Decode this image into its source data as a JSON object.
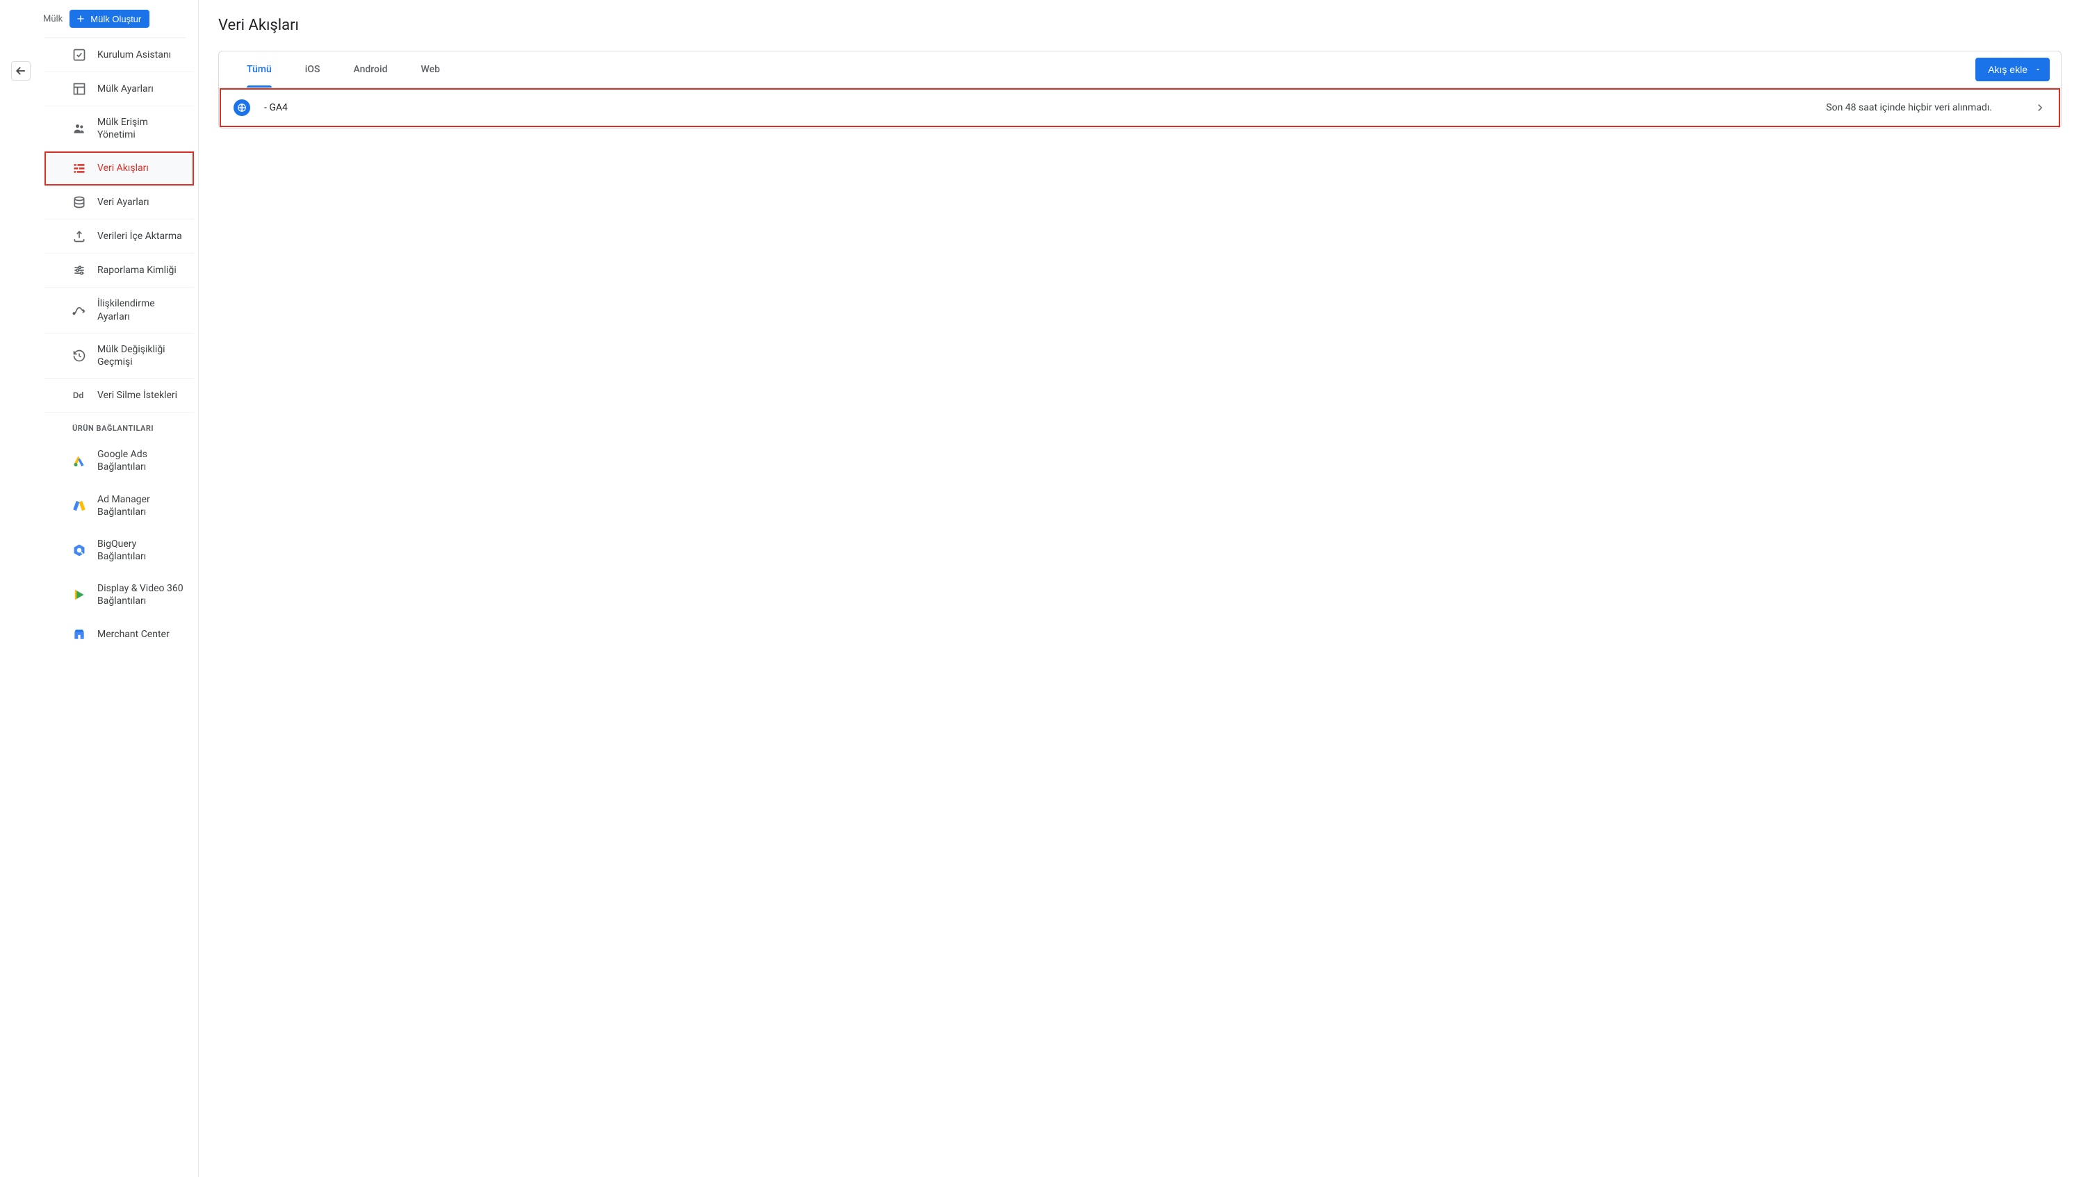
{
  "sidebar": {
    "property_label": "Mülk",
    "create_button": "Mülk Oluştur",
    "items": [
      {
        "label": "Kurulum Asistanı"
      },
      {
        "label": "Mülk Ayarları"
      },
      {
        "label": "Mülk Erişim Yönetimi"
      },
      {
        "label": "Veri Akışları"
      },
      {
        "label": "Veri Ayarları"
      },
      {
        "label": "Verileri İçe Aktarma"
      },
      {
        "label": "Raporlama Kimliği"
      },
      {
        "label": "İlişkilendirme Ayarları"
      },
      {
        "label": "Mülk Değişikliği Geçmişi"
      },
      {
        "label": "Veri Silme İstekleri"
      }
    ],
    "section_product_links": "ÜRÜN BAĞLANTILARI",
    "product_links": [
      {
        "label": "Google Ads Bağlantıları"
      },
      {
        "label": "Ad Manager Bağlantıları"
      },
      {
        "label": "BigQuery Bağlantıları"
      },
      {
        "label": "Display & Video 360 Bağlantıları"
      },
      {
        "label": "Merchant Center"
      }
    ]
  },
  "main": {
    "title": "Veri Akışları",
    "tabs": [
      {
        "label": "Tümü"
      },
      {
        "label": "iOS"
      },
      {
        "label": "Android"
      },
      {
        "label": "Web"
      }
    ],
    "add_stream_button": "Akış ekle",
    "stream": {
      "name": "- GA4",
      "status": "Son 48 saat içinde hiçbir veri alınmadı."
    }
  }
}
